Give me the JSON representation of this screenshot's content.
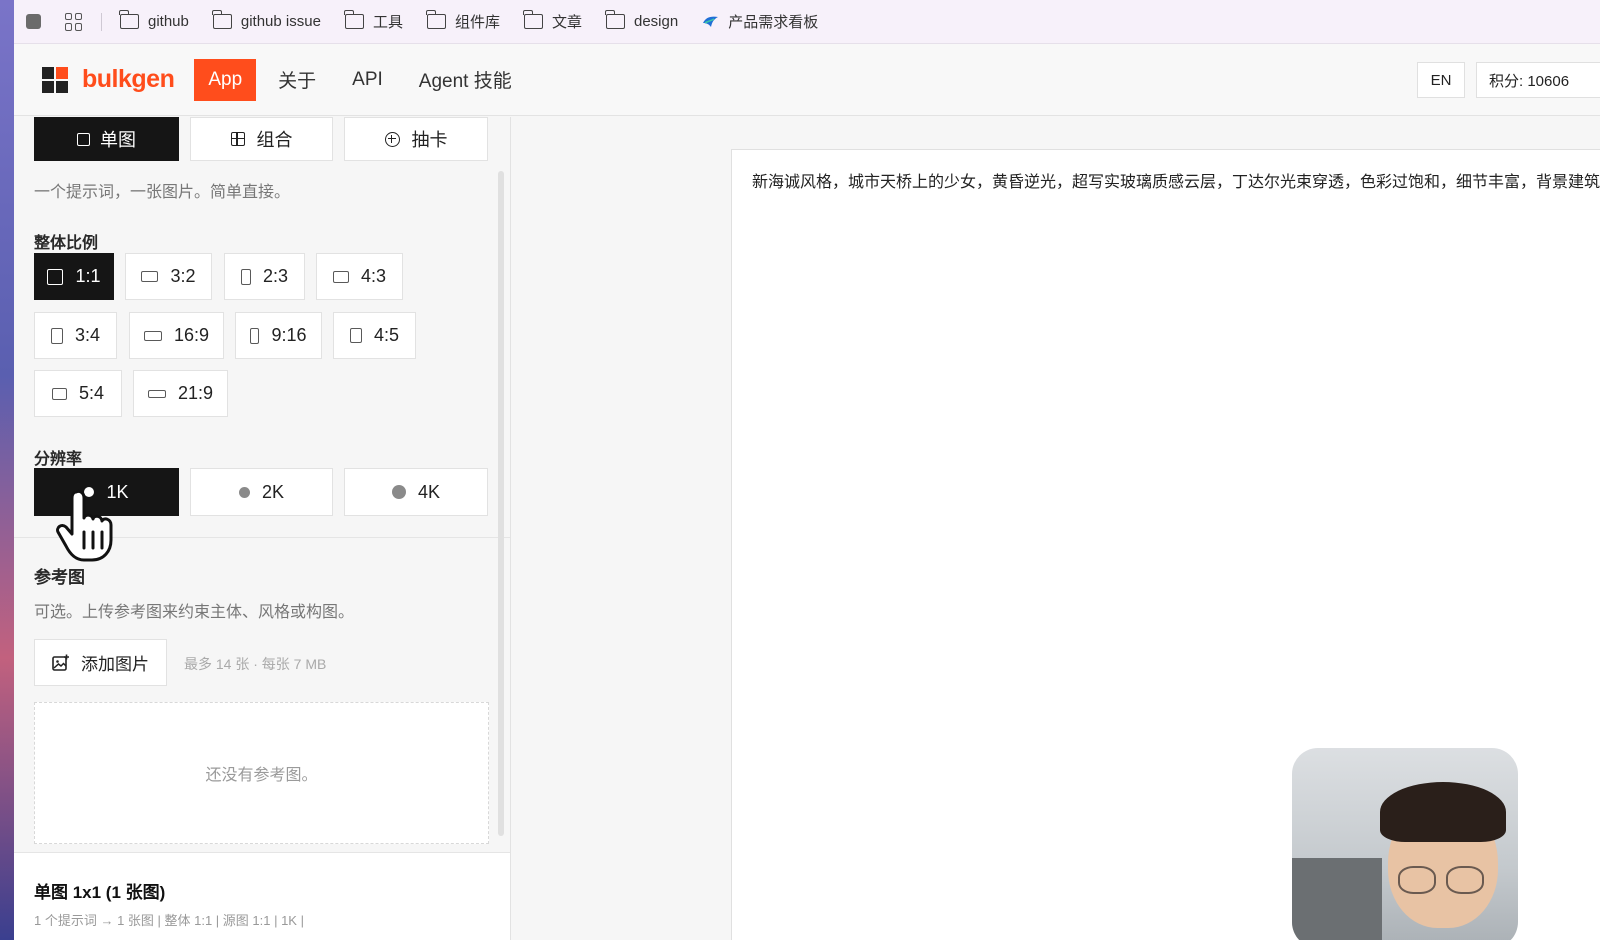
{
  "bookmarks": {
    "items": [
      {
        "label": "github",
        "icon": "folder-icon"
      },
      {
        "label": "github issue",
        "icon": "folder-icon"
      },
      {
        "label": "工具",
        "icon": "folder-icon"
      },
      {
        "label": "组件库",
        "icon": "folder-icon"
      },
      {
        "label": "文章",
        "icon": "folder-icon"
      },
      {
        "label": "design",
        "icon": "folder-icon"
      },
      {
        "label": "产品需求看板",
        "icon": "bird-icon"
      }
    ]
  },
  "header": {
    "logo": "bulkgen",
    "nav": [
      "App",
      "关于",
      "API",
      "Agent 技能"
    ],
    "lang": "EN",
    "points": "积分: 10606"
  },
  "mode_tabs": [
    {
      "label": "单图",
      "icon": "square-icon",
      "active": true
    },
    {
      "label": "组合",
      "icon": "grid-icon",
      "active": false
    },
    {
      "label": "抽卡",
      "icon": "plus-circle-icon",
      "active": false
    }
  ],
  "mode_desc": "一个提示词，一张图片。简单直接。",
  "ratio": {
    "label": "整体比例",
    "options": [
      "1:1",
      "3:2",
      "2:3",
      "4:3",
      "3:4",
      "16:9",
      "9:16",
      "4:5",
      "5:4",
      "21:9"
    ],
    "selected": "1:1"
  },
  "resolution": {
    "label": "分辨率",
    "options": [
      "1K",
      "2K",
      "4K"
    ],
    "selected": "1K"
  },
  "reference": {
    "label": "参考图",
    "desc": "可选。上传参考图来约束主体、风格或构图。",
    "add_button": "添加图片",
    "limit": "最多 14 张 · 每张 7 MB",
    "empty": "还没有参考图。"
  },
  "summary": {
    "title": "单图 1x1 (1 张图)",
    "detail": "1 个提示词 → 1 张图 | 整体 1:1 | 源图 1:1 | 1K |"
  },
  "prompt": {
    "text": "新海诚风格，城市天桥上的少女，黄昏逆光，超写实玻璃质感云层，丁达尔光束穿透，色彩过饱和，细节丰富，背景建筑"
  },
  "colors": {
    "accent": "#ff4d1c",
    "active_bg": "#151515"
  }
}
